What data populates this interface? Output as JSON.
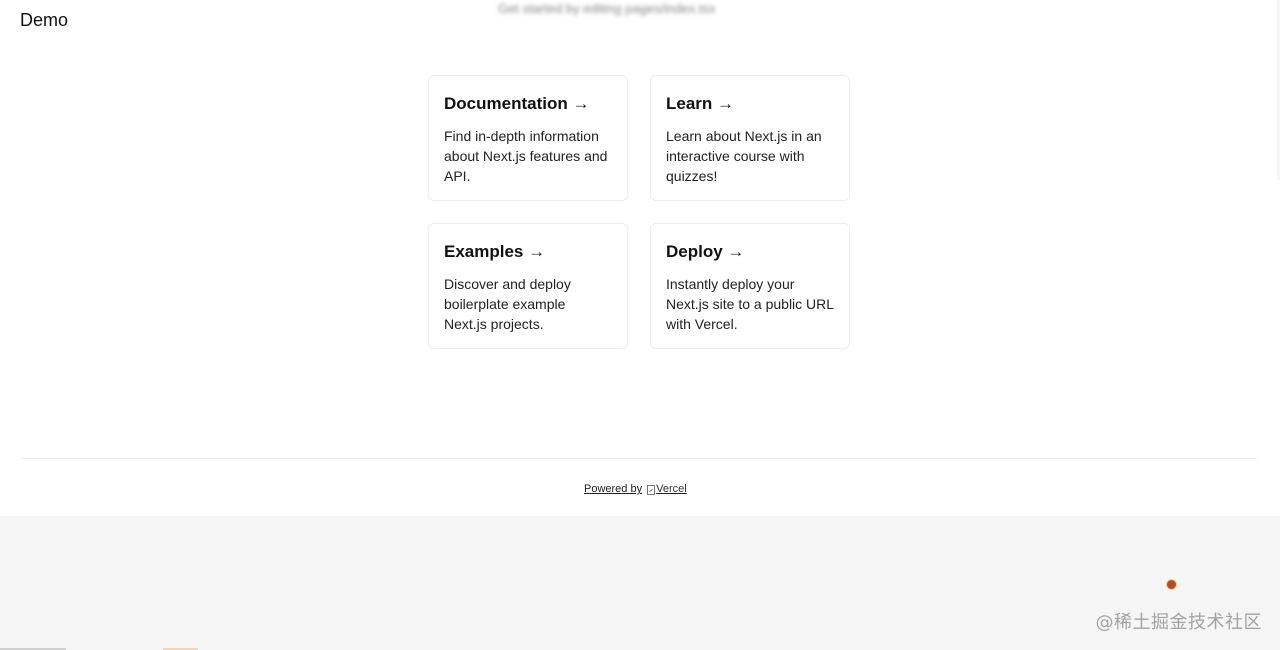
{
  "brand": "Demo",
  "blurred_hint": "Get started by editing pages/index.tsx",
  "cards": [
    {
      "title": "Documentation →",
      "description": "Find in-depth information about Next.js features and API."
    },
    {
      "title": "Learn →",
      "description": "Learn about Next.js in an interactive course with quizzes!"
    },
    {
      "title": "Examples →",
      "description": "Discover and deploy boilerplate example Next.js projects."
    },
    {
      "title": "Deploy →",
      "description": "Instantly deploy your Next.js site to a public URL with Vercel."
    }
  ],
  "footer": {
    "powered_by": "Powered by",
    "logo_alt": "Vercel"
  },
  "watermark": "@稀土掘金技术社区",
  "colors": {
    "background": "#ffffff",
    "footer_area": "#f5f5f5",
    "card_border": "#ededed",
    "text": "#111111"
  }
}
